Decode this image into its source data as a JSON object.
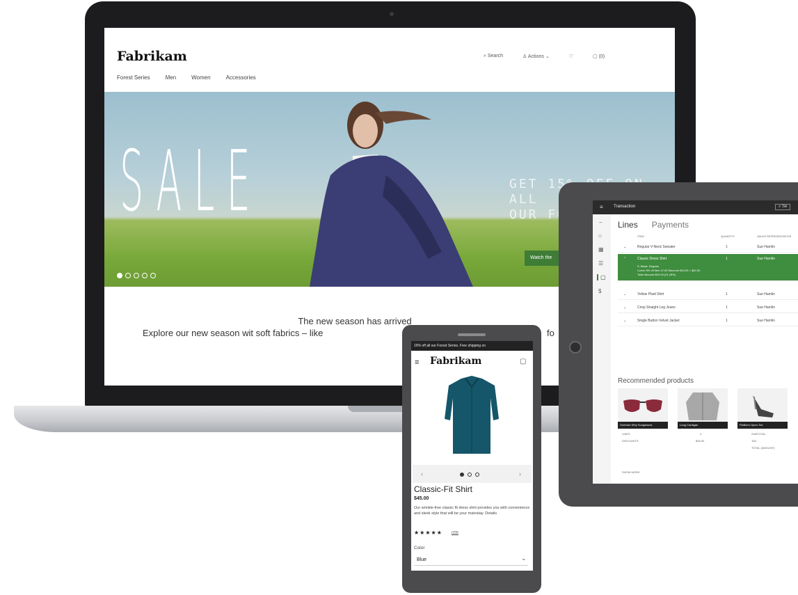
{
  "laptop": {
    "site": {
      "logo": "Fabrikam",
      "nav": [
        "Forest Series",
        "Men",
        "Women",
        "Accessories"
      ],
      "header_actions": {
        "search": "Search",
        "account": "Actions",
        "cart": "(0)"
      }
    },
    "hero": {
      "headline": "SALE",
      "offer_line1": "GET 15% OFF ON ALL",
      "offer_line2": "OUR FO",
      "cta": "Watch the",
      "slide_count": 5,
      "active_slide": 1
    },
    "tagline": "The new season has arrived",
    "tagline_sub": "Explore our new season wit soft fabrics – like",
    "tagline_tail": "fo"
  },
  "phone": {
    "promo": "15% off all our Forest Series. Free shipping on",
    "logo": "Fabrikam",
    "product": {
      "title": "Classic-Fit Shirt",
      "price": "$45.00",
      "description": "Our wrinkle-free classic fit dress shirt provides you with convenience and sleek style that will be your mainstay. Details",
      "stars": "★★★★★",
      "reviews": "(23)",
      "color_label": "Color",
      "color_value": "Blue"
    },
    "carousel": {
      "slide_count": 3,
      "active_slide": 1
    }
  },
  "tablet": {
    "title": "Transaction",
    "search": "Se",
    "tabs": [
      "Lines",
      "Payments"
    ],
    "columns": [
      "ITEM",
      "QUANTITY",
      "SALES REPRESENTATIVE"
    ],
    "rows": [
      {
        "item": "Regular V-Neck Sweater",
        "qty": "1",
        "rep": "Sue Hamlin"
      },
      {
        "item": "Classic Dress Shirt",
        "qty": "1",
        "rep": "Sue Hamlin",
        "details": "S, Black, Regular",
        "details2": "Lorem 5% off item 47.00 Discount $10.00 = $40.00",
        "details3": "Total discount $10.00 (21.28%)"
      },
      {
        "item": "Yellow Plaid Shirt",
        "qty": "1",
        "rep": "Sue Hamlin"
      },
      {
        "item": "Crisp Straight Leg Jeans",
        "qty": "1",
        "rep": "Sue Hamlin"
      },
      {
        "item": "Single Button Velvet Jacket",
        "qty": "1",
        "rep": "Sue Hamlin"
      }
    ],
    "recommended_heading": "Recommended products",
    "recommended": [
      "Overture Why Sunglasses",
      "Long Cardigan",
      "Platform Open-Toe"
    ],
    "summary": {
      "lines_label": "LINES",
      "lines_value": "4",
      "discounts_label": "DISCOUNTS",
      "discounts_value": "$35.00",
      "subtotal_label": "SUBTOTAL",
      "tax_label": "TAX",
      "total_label": "TOTAL (AMOUNT)",
      "more": "SHOW MORE"
    }
  }
}
